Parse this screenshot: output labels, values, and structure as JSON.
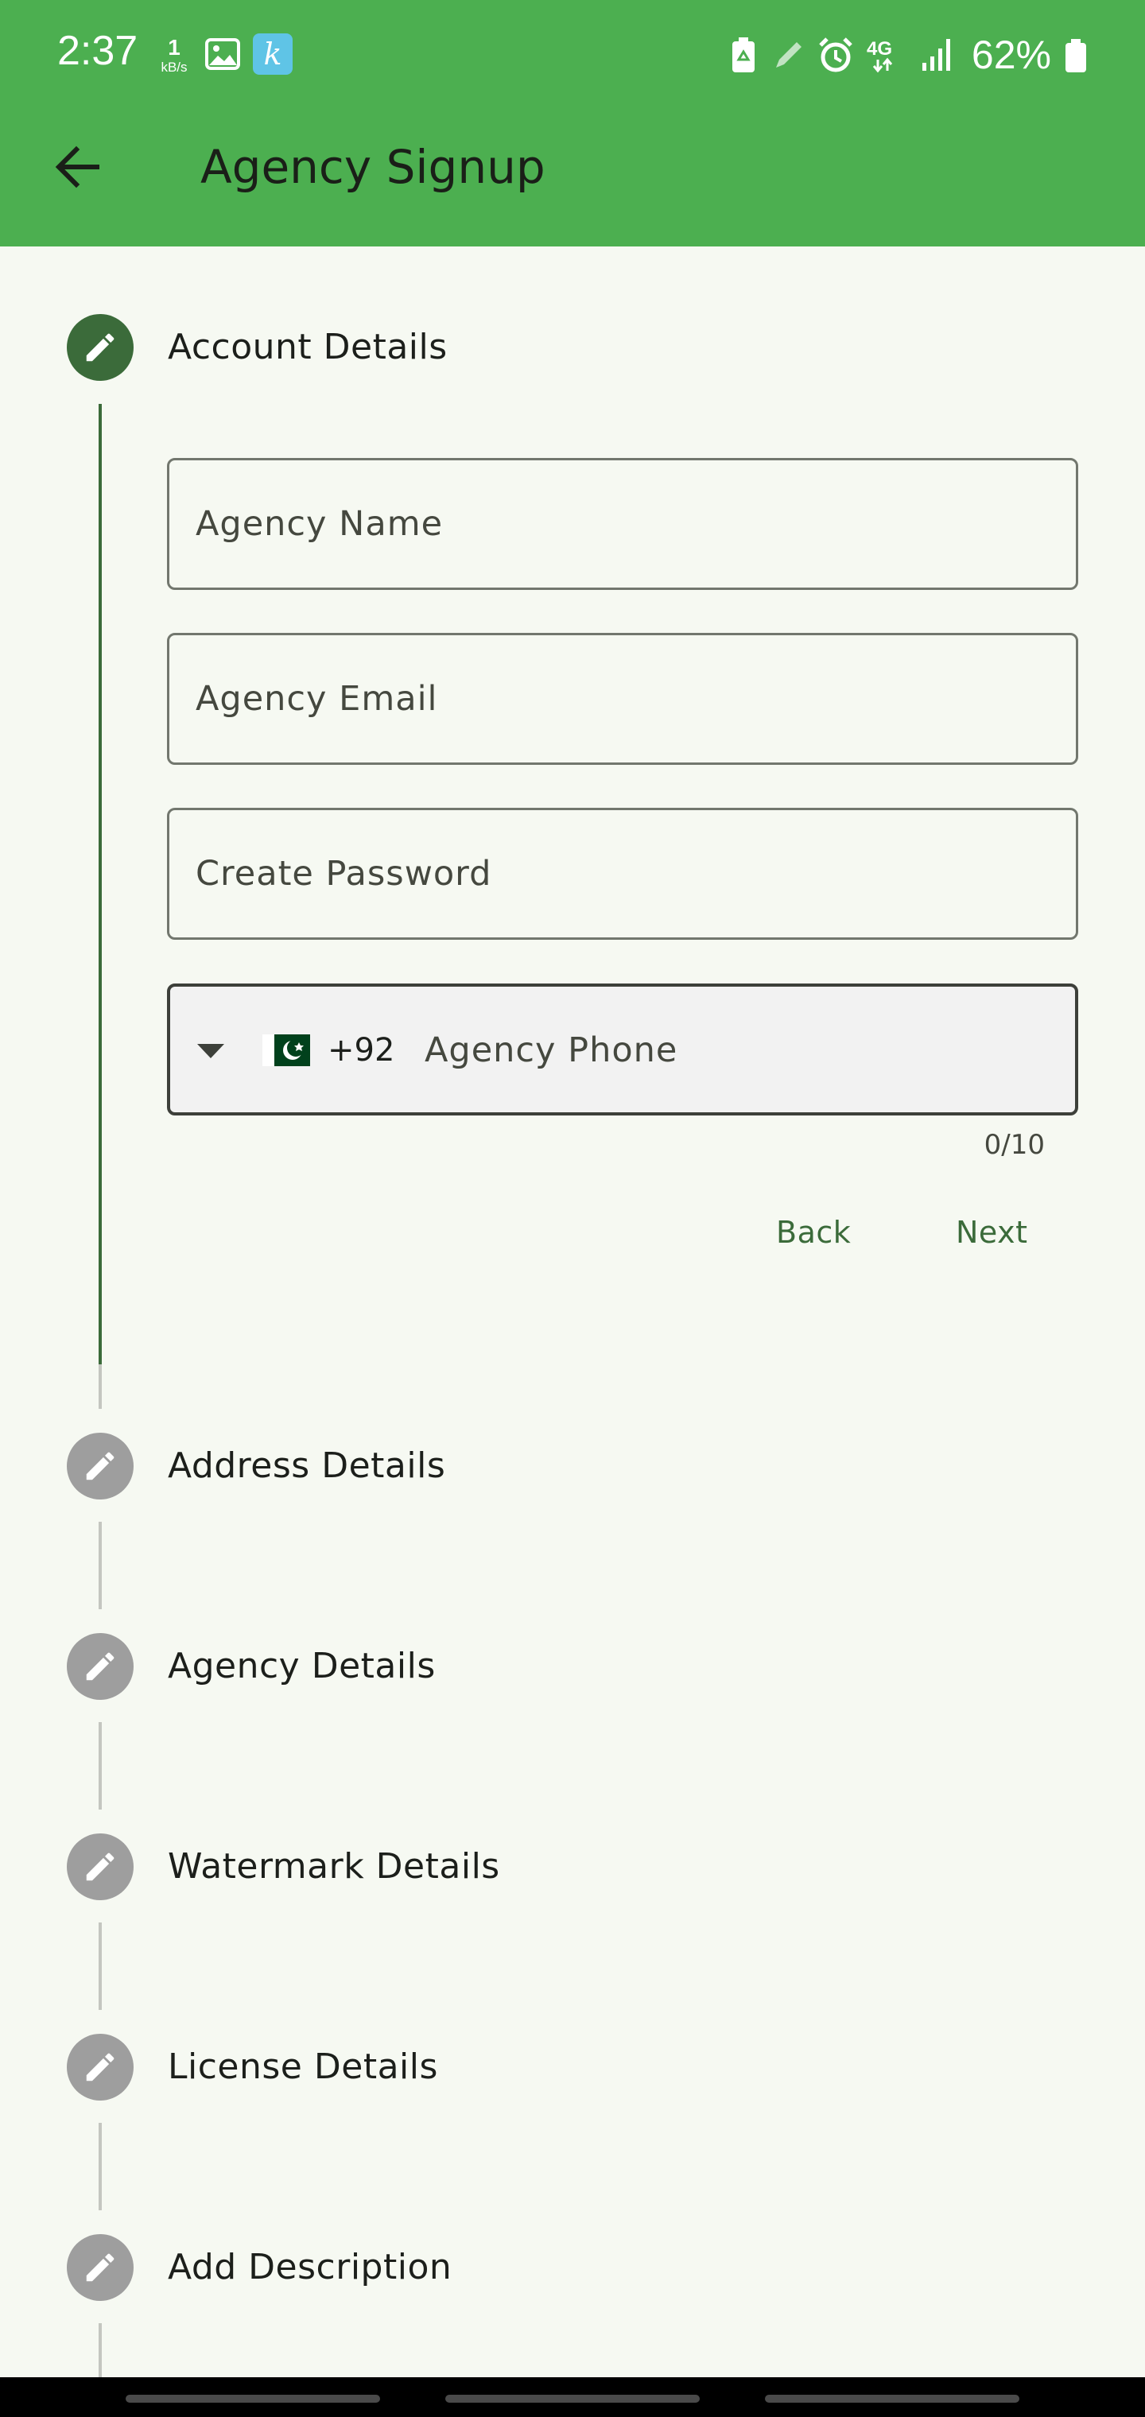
{
  "status_bar": {
    "time": "2:37",
    "net_speed_value": "1",
    "net_speed_unit": "kB/s",
    "app_icon_letter": "k",
    "network_type": "4G",
    "battery_percent": "62%"
  },
  "app_bar": {
    "title": "Agency Signup"
  },
  "stepper": {
    "steps": [
      {
        "label": "Account Details",
        "active": true
      },
      {
        "label": "Address Details",
        "active": false
      },
      {
        "label": "Agency Details",
        "active": false
      },
      {
        "label": "Watermark Details",
        "active": false
      },
      {
        "label": "License Details",
        "active": false
      },
      {
        "label": "Add Description",
        "active": false
      }
    ]
  },
  "form": {
    "agency_name_placeholder": "Agency Name",
    "agency_email_placeholder": "Agency Email",
    "password_placeholder": "Create Password",
    "phone": {
      "dial_code": "+92",
      "placeholder": "Agency Phone",
      "counter": "0/10"
    },
    "back_label": "Back",
    "next_label": "Next"
  },
  "colors": {
    "primary": "#4caf50",
    "step_active": "#3b6b3a",
    "step_inactive": "#9e9e9e",
    "background": "#f6f9f2"
  }
}
